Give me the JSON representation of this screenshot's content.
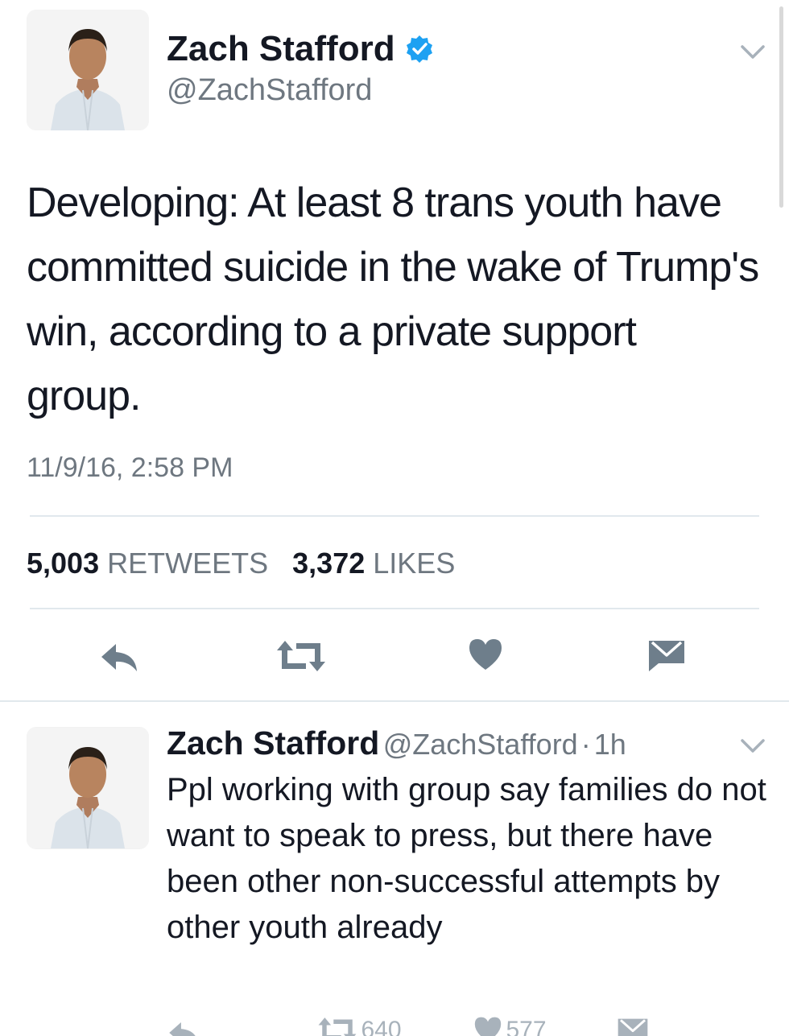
{
  "main_tweet": {
    "author": {
      "name": "Zach Stafford",
      "handle": "@ZachStafford",
      "verified": true,
      "avatar": "avatar-photo"
    },
    "text": "Developing: At least 8 trans youth have committed suicide in the wake of Trump's win, according to a private support group.",
    "timestamp": "11/9/16, 2:58 PM",
    "stats": {
      "retweets_count": "5,003",
      "retweets_label": "RETWEETS",
      "likes_count": "3,372",
      "likes_label": "LIKES"
    },
    "actions": [
      "reply-icon",
      "retweet-icon",
      "like-icon",
      "direct-message-icon"
    ]
  },
  "reply_tweet": {
    "author": {
      "name": "Zach Stafford",
      "handle": "@ZachStafford",
      "separator": "·",
      "time": "1h",
      "avatar": "avatar-photo"
    },
    "text": "Ppl working with group say families do not want to speak to press, but there have been other non-successful attempts by other youth already",
    "retweets_count": "640",
    "likes_count": "577",
    "actions": [
      "reply-icon",
      "retweet-icon",
      "like-icon",
      "direct-message-icon"
    ]
  },
  "colors": {
    "text": "#141823",
    "secondary": "#6e7780",
    "icon": "#6e7e8b",
    "verified": "#1da1f2",
    "divider": "#e1e8ed"
  }
}
